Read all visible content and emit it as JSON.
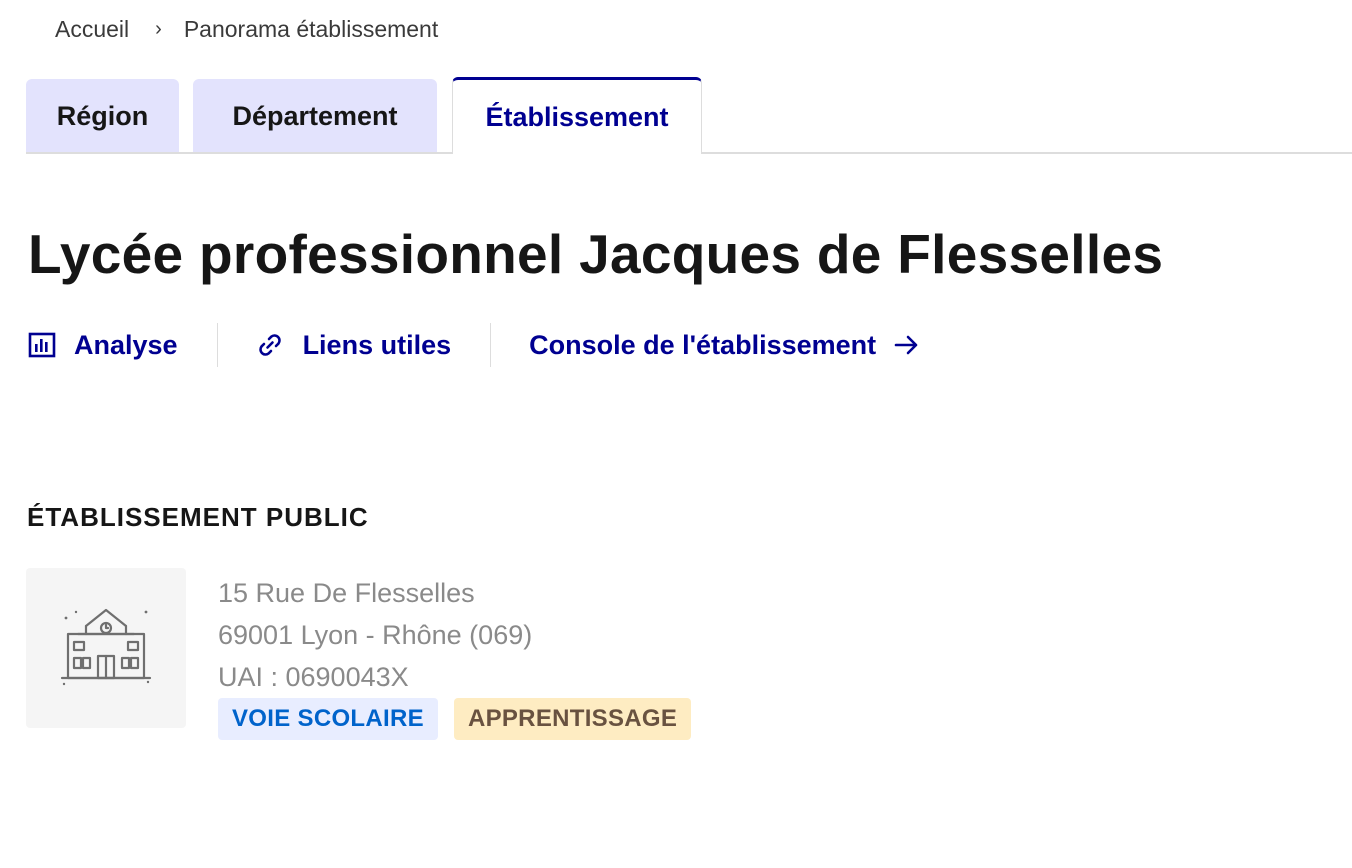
{
  "breadcrumb": {
    "home": "Accueil",
    "separator": "›",
    "current": "Panorama établissement"
  },
  "tabs": [
    {
      "label": "Région",
      "active": false
    },
    {
      "label": "Département",
      "active": false
    },
    {
      "label": "Établissement",
      "active": true
    }
  ],
  "page_title": "Lycée professionnel Jacques de Flesselles",
  "actions": {
    "analyse": {
      "label": "Analyse",
      "icon": "bar-chart-icon"
    },
    "liens": {
      "label": "Liens utiles",
      "icon": "link-icon"
    },
    "console": {
      "label": "Console de l'établissement",
      "icon": "arrow-right-icon"
    }
  },
  "section_label": "ÉTABLISSEMENT PUBLIC",
  "school": {
    "icon": "school-building-icon",
    "address_line1": "15 Rue De Flesselles",
    "address_line2": "69001 Lyon - Rhône (069)",
    "uai": "UAI : 0690043X"
  },
  "badges": [
    {
      "label": "VOIE SCOLAIRE",
      "color": "#0063cb",
      "background": "#e8edff"
    },
    {
      "label": "APPRENTISSAGE",
      "color": "#695240",
      "background": "#feecc2"
    }
  ],
  "colors": {
    "accent": "#000091",
    "tab_inactive_bg": "#e3e3fd",
    "text": "#161616",
    "muted": "#8a8a8a"
  }
}
